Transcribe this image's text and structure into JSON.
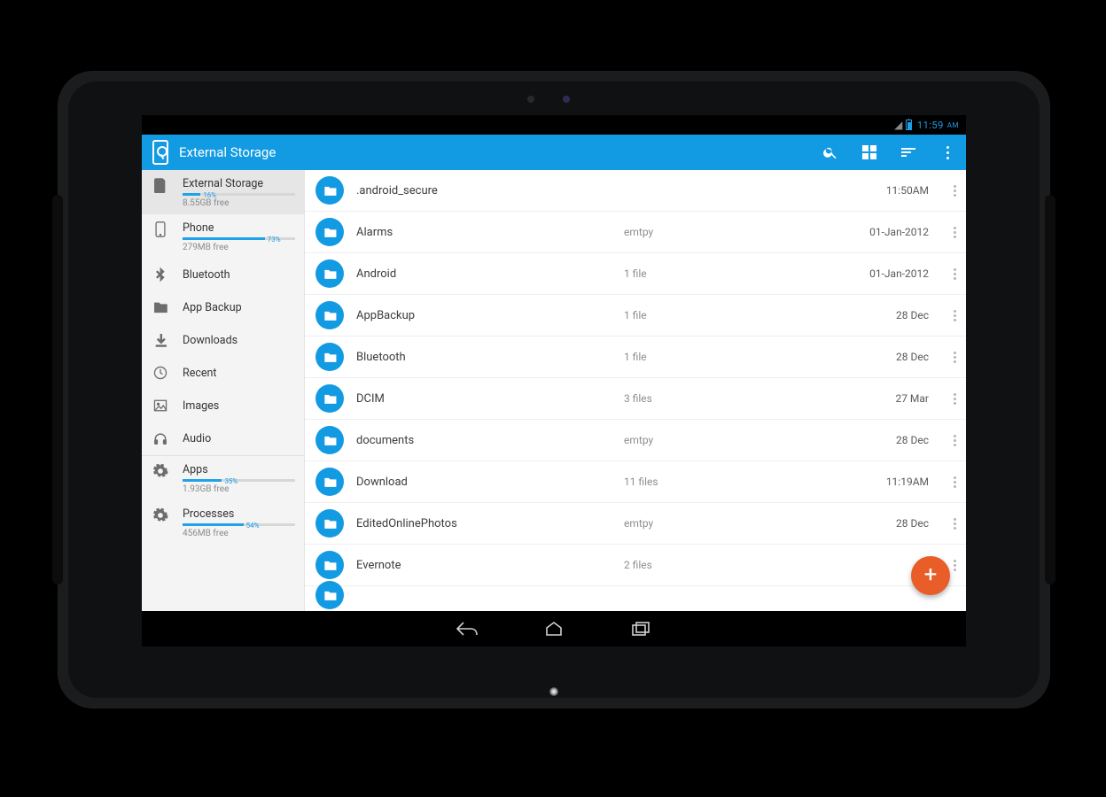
{
  "status": {
    "time": "11:59",
    "ampm": "AM"
  },
  "appbar": {
    "title": "External Storage"
  },
  "sidebar": [
    {
      "kind": "storage",
      "icon": "sd-card-icon",
      "label": "External Storage",
      "percent": 16,
      "sub": "8.55GB free",
      "selected": true
    },
    {
      "kind": "storage",
      "icon": "phone-icon",
      "label": "Phone",
      "percent": 73,
      "sub": "279MB free"
    },
    {
      "kind": "simple",
      "icon": "bluetooth-icon",
      "label": "Bluetooth"
    },
    {
      "kind": "simple",
      "icon": "folder-solid-icon",
      "label": "App Backup"
    },
    {
      "kind": "simple",
      "icon": "download-icon",
      "label": "Downloads"
    },
    {
      "kind": "simple",
      "icon": "clock-icon",
      "label": "Recent"
    },
    {
      "kind": "simple",
      "icon": "image-icon",
      "label": "Images"
    },
    {
      "kind": "simple",
      "icon": "headphones-icon",
      "label": "Audio",
      "sepAfter": true
    },
    {
      "kind": "storage",
      "icon": "gear-icon",
      "label": "Apps",
      "percent": 35,
      "sub": "1.93GB free"
    },
    {
      "kind": "storage",
      "icon": "gear-icon",
      "label": "Processes",
      "percent": 54,
      "sub": "456MB free"
    }
  ],
  "files": [
    {
      "name": ".android_secure",
      "count": "",
      "date": "11:50AM"
    },
    {
      "name": "Alarms",
      "count": "emtpy",
      "date": "01-Jan-2012"
    },
    {
      "name": "Android",
      "count": "1 file",
      "date": "01-Jan-2012"
    },
    {
      "name": "AppBackup",
      "count": "1 file",
      "date": "28 Dec"
    },
    {
      "name": "Bluetooth",
      "count": "1 file",
      "date": "28 Dec"
    },
    {
      "name": "DCIM",
      "count": "3 files",
      "date": "27 Mar"
    },
    {
      "name": "documents",
      "count": "emtpy",
      "date": "28 Dec"
    },
    {
      "name": "Download",
      "count": "11 files",
      "date": "11:19AM"
    },
    {
      "name": "EditedOnlinePhotos",
      "count": "emtpy",
      "date": "28 Dec"
    },
    {
      "name": "Evernote",
      "count": "2 files",
      "date": ""
    }
  ]
}
